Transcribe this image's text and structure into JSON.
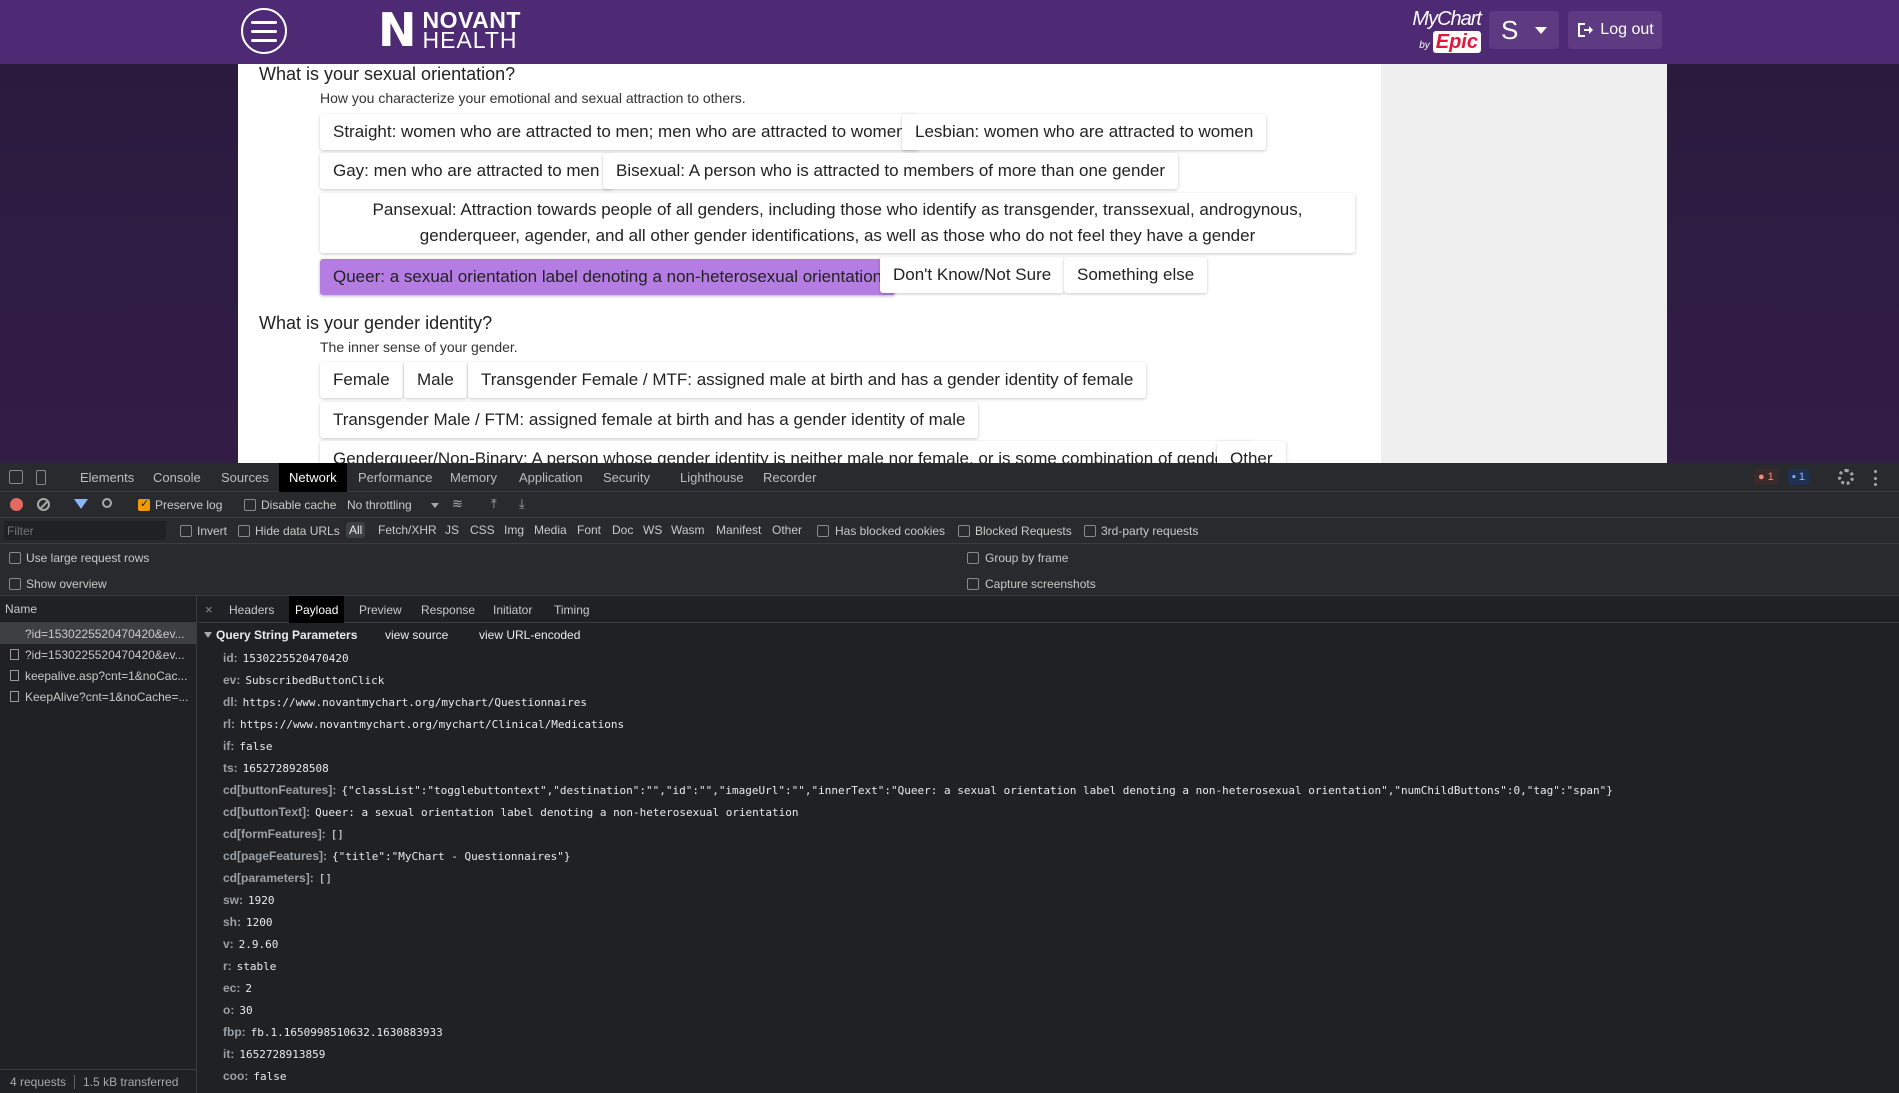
{
  "header": {
    "logo_mark": "N",
    "logo_line1": "NOVANT",
    "logo_line2": "HEALTH",
    "mychart_name": "MyChart",
    "mychart_by": "by",
    "mychart_epic": "Epic",
    "user_initial": "S",
    "logout_label": "Log out"
  },
  "questionnaire": {
    "q1": {
      "title": "What is your sexual orientation?",
      "description": "How you characterize your emotional and sexual attraction to others.",
      "options": [
        "Straight: women who are attracted to men; men who are attracted to women",
        "Lesbian: women who are attracted to women",
        "Gay: men who are attracted to men",
        "Bisexual: A person who is attracted to members of more than one gender",
        "Pansexual: Attraction towards people of all genders, including those who identify as transgender, transsexual, androgynous, genderqueer, agender, and all other gender identifications, as well as those who do not feel they have a gender",
        "Queer: a sexual orientation label denoting a non-heterosexual orientation",
        "Don't Know/Not Sure",
        "Something else"
      ],
      "selected": "Queer: a sexual orientation label denoting a non-heterosexual orientation"
    },
    "q2": {
      "title": "What is your gender identity?",
      "description": "The inner sense of your gender.",
      "options": [
        "Female",
        "Male",
        "Transgender Female / MTF: assigned male at birth and has a gender identity of female",
        "Transgender Male / FTM: assigned female at birth and has a gender identity of male",
        "Genderqueer/Non-Binary: A person whose gender identity is neither male nor female, or is some combination of genders",
        "Other"
      ]
    }
  },
  "devtools": {
    "tabs": [
      "Elements",
      "Console",
      "Sources",
      "Network",
      "Performance",
      "Memory",
      "Application",
      "Security",
      "Lighthouse",
      "Recorder"
    ],
    "active_tab": "Network",
    "error_count": "1",
    "message_count": "1",
    "toolbar": {
      "preserve_log": "Preserve log",
      "disable_cache": "Disable cache",
      "throttling": "No throttling"
    },
    "filter": {
      "placeholder": "Filter",
      "invert": "Invert",
      "hide_data_urls": "Hide data URLs",
      "types": [
        "All",
        "Fetch/XHR",
        "JS",
        "CSS",
        "Img",
        "Media",
        "Font",
        "Doc",
        "WS",
        "Wasm",
        "Manifest",
        "Other"
      ],
      "has_blocked_cookies": "Has blocked cookies",
      "blocked_requests": "Blocked Requests",
      "third_party": "3rd-party requests"
    },
    "options": {
      "large_rows": "Use large request rows",
      "show_overview": "Show overview",
      "group_by_frame": "Group by frame",
      "capture_screenshots": "Capture screenshots"
    },
    "requests": {
      "header": "Name",
      "items": [
        "?id=1530225520470420&ev...",
        "?id=1530225520470420&ev...",
        "keepalive.asp?cnt=1&noCac...",
        "KeepAlive?cnt=1&noCache=..."
      ],
      "status_count": "4 requests",
      "status_transferred": "1.5 kB transferred"
    },
    "detail": {
      "tabs": [
        "Headers",
        "Payload",
        "Preview",
        "Response",
        "Initiator",
        "Timing"
      ],
      "active": "Payload",
      "section_title": "Query String Parameters",
      "view_source": "view source",
      "view_url_encoded": "view URL-encoded",
      "params": [
        {
          "key": "id:",
          "value": "1530225520470420"
        },
        {
          "key": "ev:",
          "value": "SubscribedButtonClick"
        },
        {
          "key": "dl:",
          "value": "https://www.novantmychart.org/mychart/Questionnaires"
        },
        {
          "key": "rl:",
          "value": "https://www.novantmychart.org/mychart/Clinical/Medications"
        },
        {
          "key": "if:",
          "value": "false"
        },
        {
          "key": "ts:",
          "value": "1652728928508"
        },
        {
          "key": "cd[buttonFeatures]:",
          "value": "{\"classList\":\"togglebuttontext\",\"destination\":\"\",\"id\":\"\",\"imageUrl\":\"\",\"innerText\":\"Queer: a sexual orientation label denoting a non-heterosexual orientation\",\"numChildButtons\":0,\"tag\":\"span\"}"
        },
        {
          "key": "cd[buttonText]:",
          "value": "Queer: a sexual orientation label denoting a non-heterosexual orientation"
        },
        {
          "key": "cd[formFeatures]:",
          "value": "[]"
        },
        {
          "key": "cd[pageFeatures]:",
          "value": "{\"title\":\"MyChart - Questionnaires\"}"
        },
        {
          "key": "cd[parameters]:",
          "value": "[]"
        },
        {
          "key": "sw:",
          "value": "1920"
        },
        {
          "key": "sh:",
          "value": "1200"
        },
        {
          "key": "v:",
          "value": "2.9.60"
        },
        {
          "key": "r:",
          "value": "stable"
        },
        {
          "key": "ec:",
          "value": "2"
        },
        {
          "key": "o:",
          "value": "30"
        },
        {
          "key": "fbp:",
          "value": "fb.1.1650998510632.1630883933"
        },
        {
          "key": "it:",
          "value": "1652728913859"
        },
        {
          "key": "coo:",
          "value": "false"
        }
      ]
    }
  }
}
